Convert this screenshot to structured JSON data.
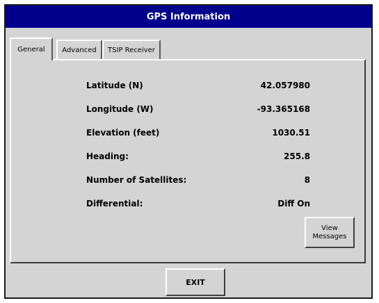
{
  "window": {
    "title": "GPS Information"
  },
  "tabs": [
    {
      "label": "General",
      "active": true
    },
    {
      "label": "Advanced",
      "active": false
    },
    {
      "label": "TSIP Receiver",
      "active": false
    }
  ],
  "fields": [
    {
      "label": "Latitude (N)",
      "value": "42.057980"
    },
    {
      "label": "Longitude (W)",
      "value": "-93.365168"
    },
    {
      "label": "Elevation (feet)",
      "value": "1030.51"
    },
    {
      "label": "Heading:",
      "value": "255.8"
    },
    {
      "label": "Number of Satellites:",
      "value": "8"
    },
    {
      "label": "Differential:",
      "value": "Diff On"
    }
  ],
  "buttons": {
    "view_messages": "View\nMessages",
    "exit": "EXIT"
  },
  "colors": {
    "titlebar": "#00008c",
    "surface": "#d4d4d4"
  }
}
